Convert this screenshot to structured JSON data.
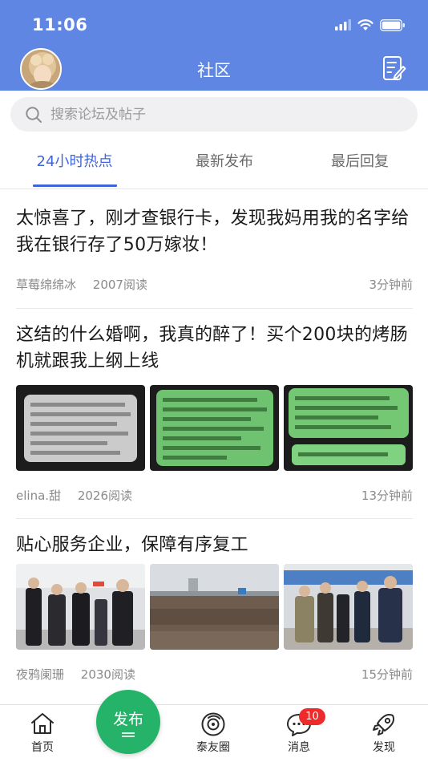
{
  "status_bar": {
    "time": "11:06"
  },
  "header": {
    "title": "社区"
  },
  "search": {
    "placeholder": "搜索论坛及帖子"
  },
  "tabs": [
    {
      "label": "24小时热点",
      "active": true
    },
    {
      "label": "最新发布",
      "active": false
    },
    {
      "label": "最后回复",
      "active": false
    }
  ],
  "posts": [
    {
      "title": "太惊喜了，刚才查银行卡，发现我妈用我的名字给我在银行存了50万嫁妆！",
      "author": "草莓绵绵冰",
      "reads": "2007阅读",
      "time": "3分钟前"
    },
    {
      "title": "这结的什么婚啊，我真的醉了！买个200块的烤肠机就跟我上纲上线",
      "author": "elina.甜",
      "reads": "2026阅读",
      "time": "13分钟前",
      "images": [
        "blurred-chat-screenshot",
        "blurred-chat-screenshot",
        "blurred-chat-screenshot"
      ]
    },
    {
      "title": "贴心服务企业，保障有序复工",
      "author": "夜鸦阑珊",
      "reads": "2030阅读",
      "time": "15分钟前",
      "images": [
        "officials-indoor-photo",
        "construction-site-photo",
        "officials-outdoor-photo"
      ]
    }
  ],
  "bottom_nav": {
    "home": "首页",
    "publish": "发布",
    "circle": "泰友圈",
    "messages": "消息",
    "messages_badge": "10",
    "discover": "发现"
  },
  "colors": {
    "header_bg": "#5e86e2",
    "tab_active": "#3d64d8",
    "publish_green": "#25b36a",
    "badge_red": "#ef2a2a"
  }
}
